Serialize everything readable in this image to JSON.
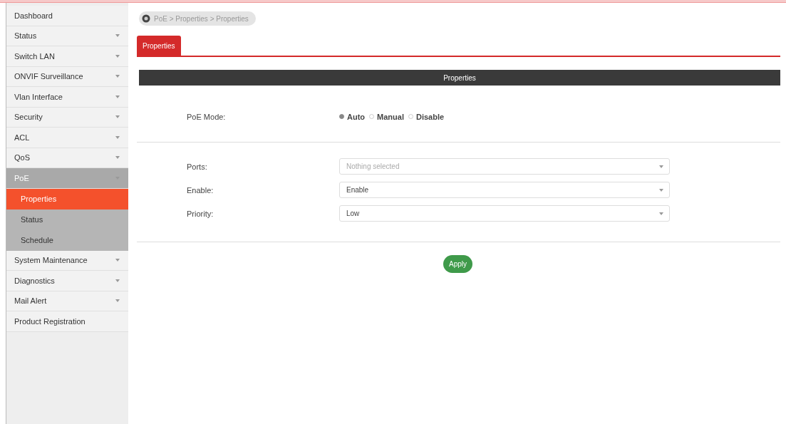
{
  "sidebar": {
    "items": [
      {
        "label": "Dashboard",
        "kind": "link",
        "expanded": false
      },
      {
        "label": "Status",
        "kind": "menu",
        "expanded": false
      },
      {
        "label": "Switch LAN",
        "kind": "menu",
        "expanded": false
      },
      {
        "label": "ONVIF Surveillance",
        "kind": "menu",
        "expanded": false
      },
      {
        "label": "Vlan Interface",
        "kind": "menu",
        "expanded": false
      },
      {
        "label": "Security",
        "kind": "menu",
        "expanded": false
      },
      {
        "label": "ACL",
        "kind": "menu",
        "expanded": false
      },
      {
        "label": "QoS",
        "kind": "menu",
        "expanded": false
      },
      {
        "label": "PoE",
        "kind": "menu",
        "expanded": true,
        "children": [
          {
            "label": "Properties",
            "selected": true
          },
          {
            "label": "Status",
            "selected": false
          },
          {
            "label": "Schedule",
            "selected": false
          }
        ]
      },
      {
        "label": "System Maintenance",
        "kind": "menu",
        "expanded": false
      },
      {
        "label": "Diagnostics",
        "kind": "menu",
        "expanded": false
      },
      {
        "label": "Mail Alert",
        "kind": "menu",
        "expanded": false
      },
      {
        "label": "Product Registration",
        "kind": "link",
        "expanded": false
      }
    ]
  },
  "breadcrumb": "PoE > Properties > Properties",
  "tabs": [
    {
      "label": "Properties",
      "selected": true
    }
  ],
  "panel": {
    "title": "Properties",
    "poe_mode": {
      "label": "PoE Mode:",
      "options": [
        {
          "label": "Auto",
          "selected": true
        },
        {
          "label": "Manual",
          "selected": false
        },
        {
          "label": "Disable",
          "selected": false
        }
      ]
    },
    "fields": [
      {
        "label": "Ports:",
        "placeholder": "Nothing selected"
      },
      {
        "label": "Enable:",
        "value": "Enable"
      },
      {
        "label": "Priority:",
        "value": "Low"
      }
    ],
    "apply_button": "Apply"
  }
}
